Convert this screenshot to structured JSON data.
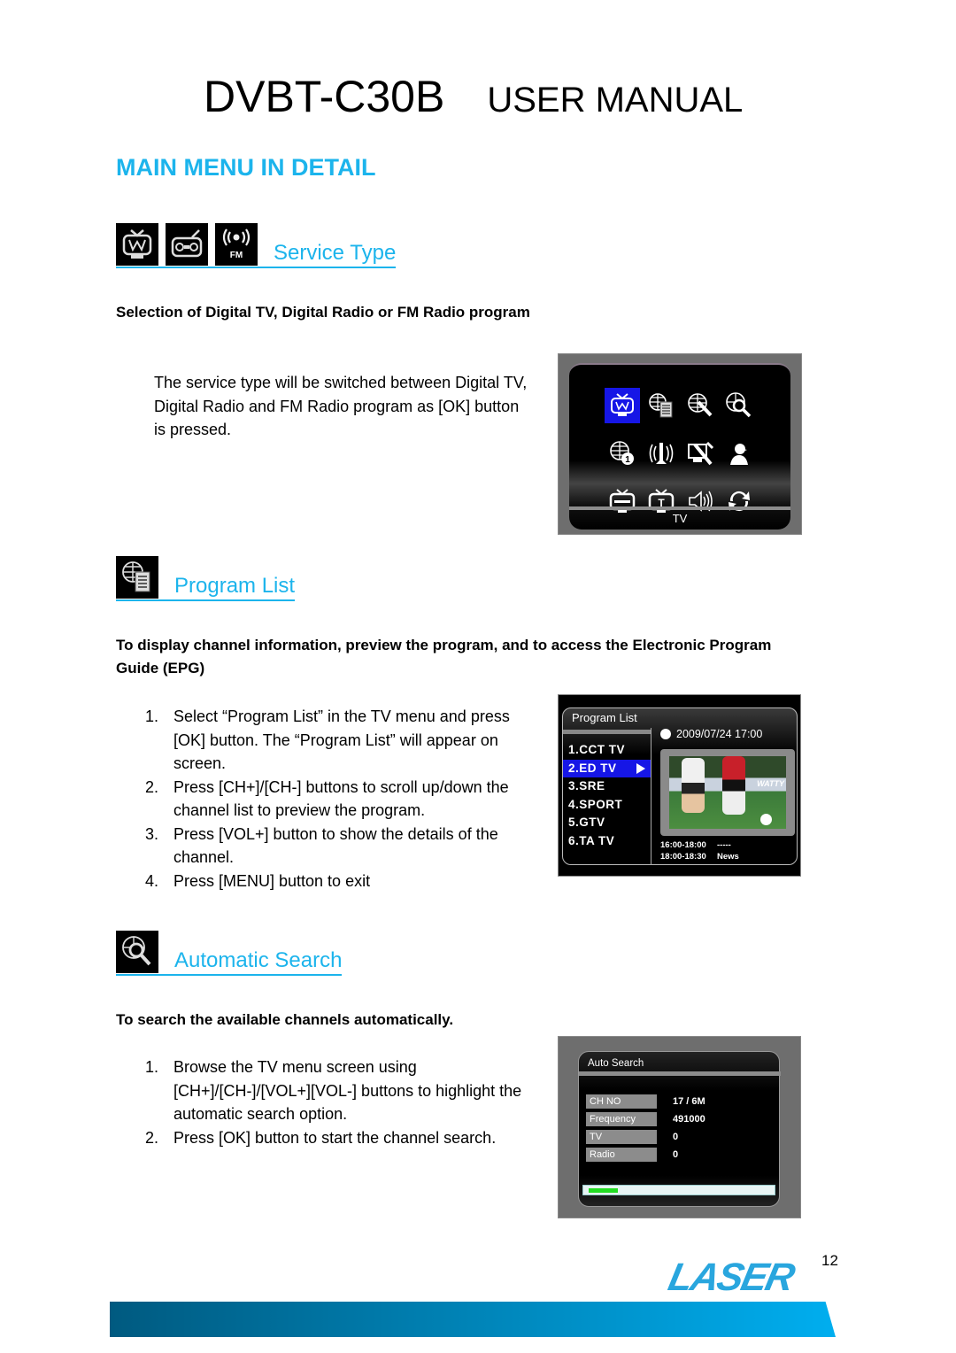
{
  "header": {
    "model": "DVBT-C30B",
    "manual": "USER MANUAL"
  },
  "section_title": "MAIN MENU IN DETAIL",
  "service_type": {
    "icons": [
      "tv-icon",
      "radio-icon",
      "fm-radio-icon"
    ],
    "fm_label": "FM",
    "heading": "Service Type",
    "subheading": "Selection of Digital TV, Digital Radio or FM Radio program",
    "description": "The service type will be switched between Digital TV, Digital Radio and FM Radio program as [OK] button is pressed.",
    "screen": {
      "caption": "TV",
      "icons": [
        "tv-icon",
        "program-list-icon",
        "setup-icon",
        "auto-search-icon",
        "info-icon",
        "antenna-icon",
        "system-tools-icon",
        "user-icon",
        "subtitle-icon",
        "teletext-icon",
        "audio-icon",
        "refresh-icon"
      ],
      "selected_index": 0,
      "accent": "#1616e6"
    }
  },
  "program_list": {
    "heading": "Program List",
    "subheading": "To display channel information, preview the program, and to access the Electronic Program Guide (EPG)",
    "steps": [
      {
        "num": "1.",
        "text": "Select “Program List” in the TV menu and press [OK] button. The “Program List” will appear on screen."
      },
      {
        "num": "2.",
        "text": "Press [CH+]/[CH-] buttons to scroll up/down the channel list to preview the program."
      },
      {
        "num": "3.",
        "text": "Press [VOL+] button to show the details of the channel."
      },
      {
        "num": "4.",
        "text": "Press [MENU] button to exit"
      }
    ],
    "screen": {
      "title": "Program List",
      "datetime": "2009/07/24 17:00",
      "channels": [
        "1.CCT TV",
        "2.ED TV",
        "3.SRE",
        "4.SPORT",
        "5.GTV",
        "6.TA TV"
      ],
      "selected_index": 1,
      "banner": "WATTY",
      "epg": [
        {
          "time": "16:00-18:00",
          "title": "-----"
        },
        {
          "time": "18:00-18:30",
          "title": "News"
        }
      ]
    }
  },
  "automatic_search": {
    "heading": "Automatic Search",
    "subheading": "To search the available channels automatically.",
    "steps": [
      {
        "num": "1.",
        "text": "Browse the TV menu screen using [CH+]/[CH-]/[VOL+][VOL-] buttons to highlight the automatic search option."
      },
      {
        "num": "2.",
        "text": "Press [OK] button to start the channel search."
      }
    ],
    "screen": {
      "title": "Auto Search",
      "rows": [
        {
          "label": "CH NO",
          "value": "17 / 6M"
        },
        {
          "label": "Frequency",
          "value": "491000"
        },
        {
          "label": "TV",
          "value": "0"
        },
        {
          "label": "Radio",
          "value": "0"
        }
      ],
      "progress_percent": 16,
      "progress_color": "#22dd22"
    }
  },
  "footer": {
    "page_number": "12",
    "logo": "LASER",
    "brand_color": "#29a6de"
  }
}
